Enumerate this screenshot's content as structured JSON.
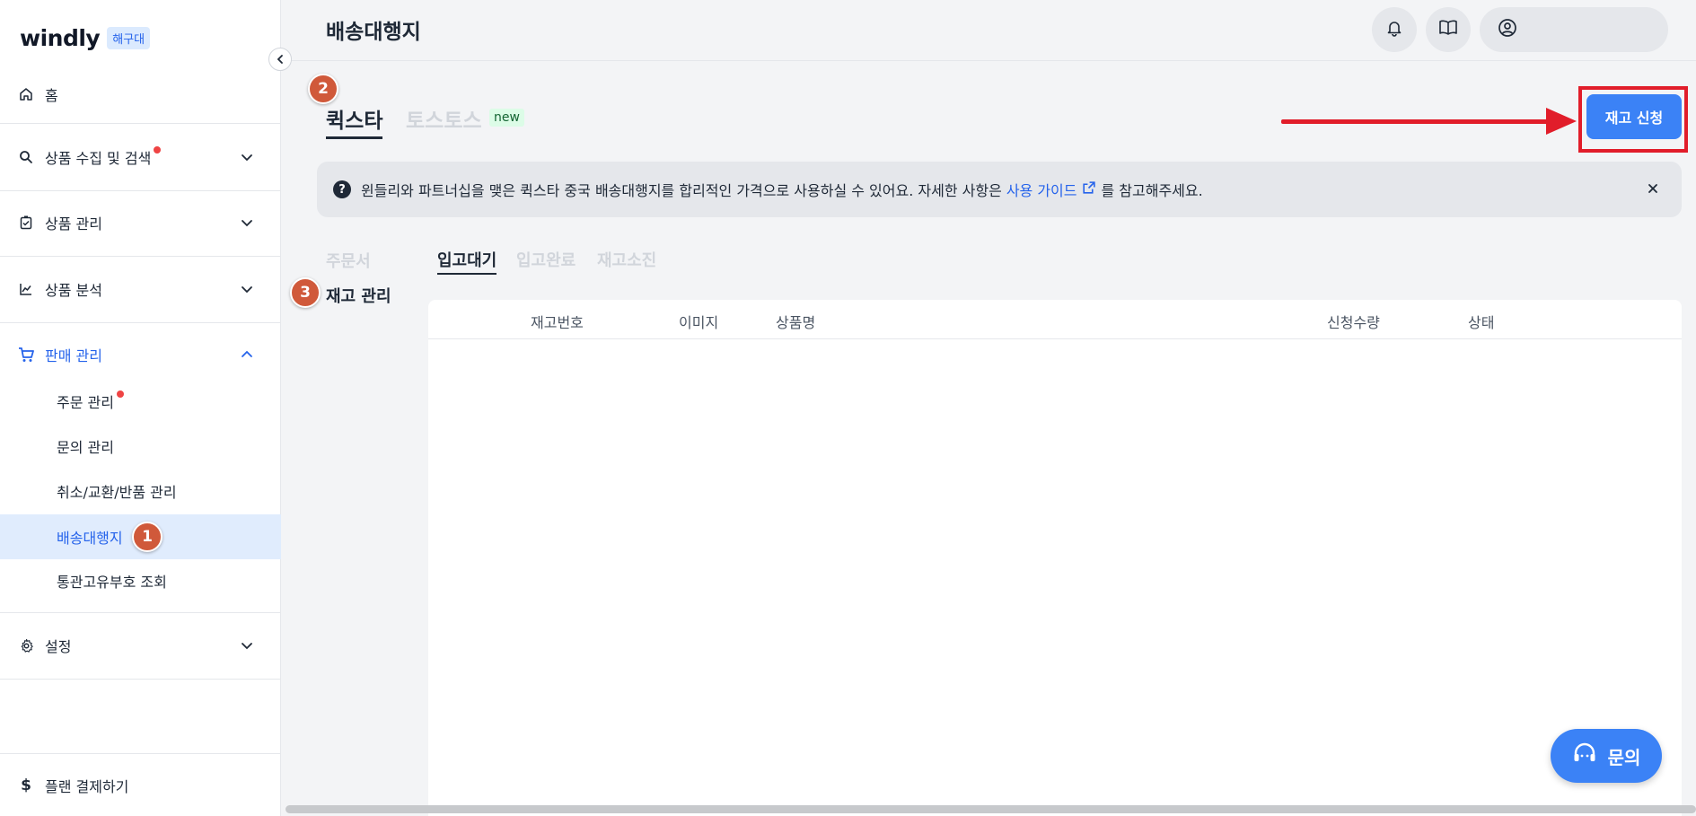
{
  "logo": {
    "text": "windly",
    "badge": "해구대"
  },
  "sidebar": {
    "home": "홈",
    "search": "상품 수집 및 검색",
    "product_mgmt": "상품 관리",
    "product_analysis": "상품 분석",
    "sales_mgmt": "판매 관리",
    "sub_items": [
      "주문 관리",
      "문의 관리",
      "취소/교환/반품 관리",
      "배송대행지",
      "통관고유부호 조회"
    ],
    "settings": "설정",
    "plan": "플랜 결제하기"
  },
  "header": {
    "title": "배송대행지"
  },
  "markers": [
    "1",
    "2",
    "3"
  ],
  "provider_tabs": [
    {
      "label": "퀵스타",
      "active": true
    },
    {
      "label": "토스토스",
      "active": false
    }
  ],
  "new_badge": "new",
  "apply_button": "재고 신청",
  "banner": {
    "text": "윈들리와 파트너십을 맺은 퀵스타 중국 배송대행지를 합리적인 가격으로 사용하실 수 있어요. 자세한 사항은",
    "link": "사용 가이드",
    "suffix": "를 참고해주세요."
  },
  "left_nav": {
    "order": "주문서",
    "stock": "재고 관리"
  },
  "status_tabs": [
    "입고대기",
    "입고완료",
    "재고소진"
  ],
  "table": {
    "columns": [
      "재고번호",
      "이미지",
      "상품명",
      "신청수량",
      "상태"
    ]
  },
  "fab": {
    "label": "문의"
  },
  "colors": {
    "accent": "#3b82f6",
    "annotation": "#e11d2a",
    "marker": "#d0593a"
  }
}
